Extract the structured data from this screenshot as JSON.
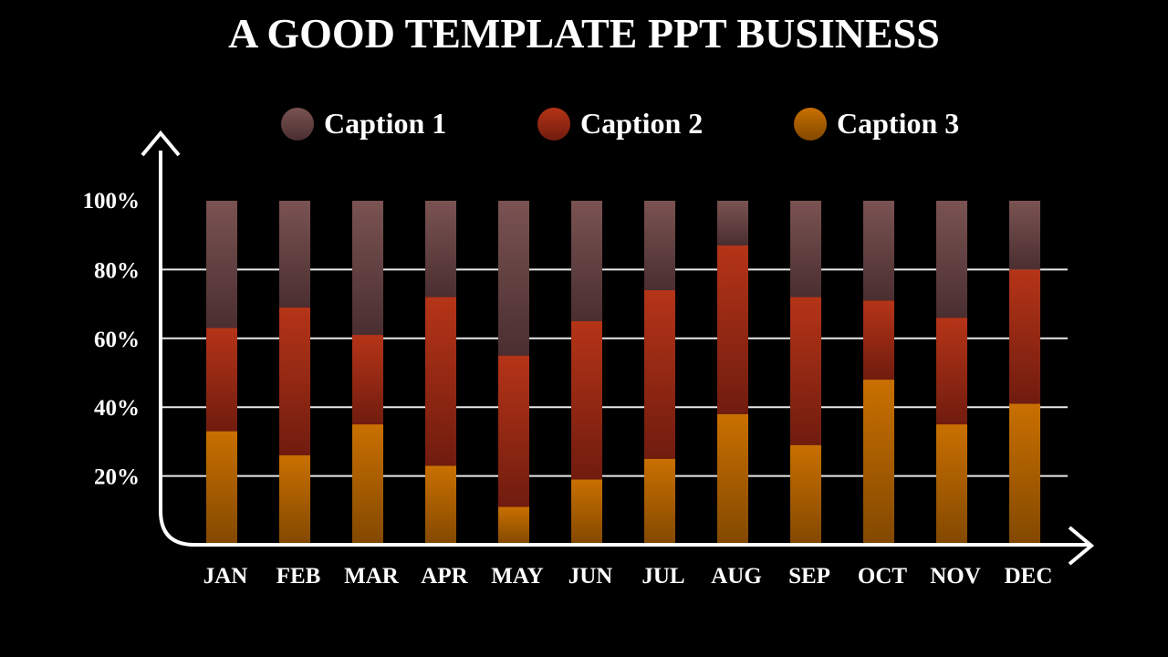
{
  "chart_data": {
    "type": "bar",
    "stacked": true,
    "title": "A GOOD TEMPLATE PPT BUSINESS",
    "xlabel": "",
    "ylabel": "",
    "categories": [
      "JAN",
      "FEB",
      "MAR",
      "APR",
      "MAY",
      "JUN",
      "JUL",
      "AUG",
      "SEP",
      "OCT",
      "NOV",
      "DEC"
    ],
    "series": [
      {
        "name": "Caption 3",
        "color_top": "#c97000",
        "color_bottom": "#824800",
        "values": [
          33,
          26,
          35,
          23,
          11,
          19,
          25,
          38,
          29,
          48,
          35,
          41
        ]
      },
      {
        "name": "Caption 2",
        "color_top": "#b53417",
        "color_bottom": "#701c0f",
        "values": [
          30,
          43,
          26,
          49,
          44,
          46,
          49,
          49,
          43,
          23,
          31,
          39
        ]
      },
      {
        "name": "Caption 1",
        "color_top": "#7a5352",
        "color_bottom": "#4a2e30",
        "values": [
          37,
          31,
          39,
          28,
          45,
          35,
          26,
          13,
          28,
          29,
          34,
          20
        ]
      }
    ],
    "legend_order": [
      "Caption 1",
      "Caption 2",
      "Caption 3"
    ],
    "legend_position": "top",
    "yticks": [
      "20%",
      "40%",
      "60%",
      "80%",
      "100%"
    ],
    "ytick_values": [
      20,
      40,
      60,
      80,
      100
    ],
    "ylim": [
      0,
      100
    ],
    "grid": true
  }
}
